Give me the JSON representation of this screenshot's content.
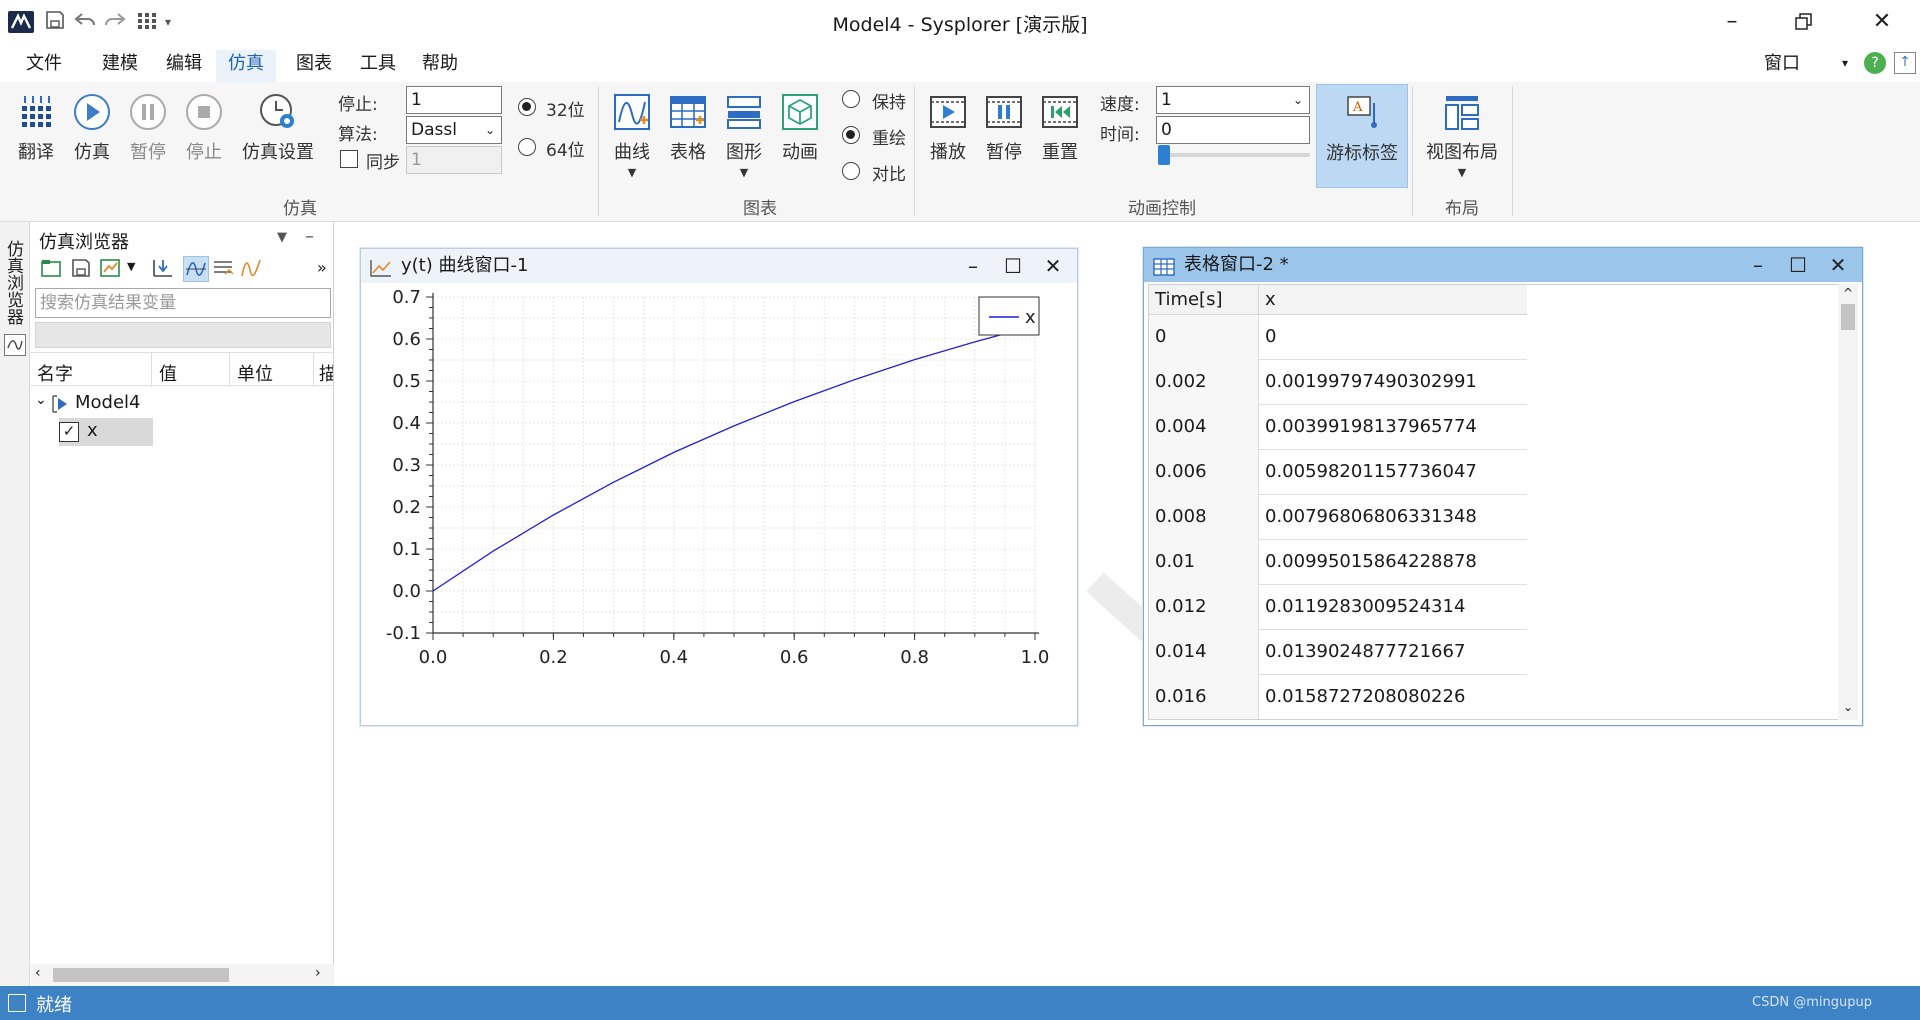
{
  "app": {
    "title": "Model4 - Sysplorer [演示版]"
  },
  "menu": {
    "items": [
      "文件",
      "建模",
      "编辑",
      "仿真",
      "图表",
      "工具",
      "帮助"
    ],
    "active": "仿真",
    "right_window_label": "窗口"
  },
  "ribbon": {
    "sim_group": {
      "label": "仿真",
      "buttons": [
        "翻译",
        "仿真",
        "暂停",
        "停止",
        "仿真设置"
      ],
      "stop_label": "停止:",
      "stop_value": "1",
      "algo_label": "算法:",
      "algo_value": "Dassl",
      "sync_label": "同步",
      "sync_value": "1",
      "bits32": "32位",
      "bits64": "64位"
    },
    "chart_group": {
      "label": "图表",
      "buttons": [
        "曲线",
        "表格",
        "图形",
        "动画"
      ],
      "modes": [
        "保持",
        "重绘",
        "对比"
      ],
      "selected_mode": "重绘"
    },
    "anim_group": {
      "label": "动画控制",
      "buttons": [
        "播放",
        "暂停",
        "重置"
      ],
      "speed_label": "速度:",
      "speed_value": "1",
      "time_label": "时间:",
      "time_value": "0",
      "cursor_label": "游标标签"
    },
    "layout_group": {
      "label": "布局",
      "button": "视图布局"
    }
  },
  "left_tab": "仿真浏览器",
  "browser": {
    "title": "仿真浏览器",
    "search_placeholder": "搜索仿真结果变量",
    "columns": [
      "名字",
      "值",
      "单位",
      "描"
    ],
    "tree": {
      "root": "Model4",
      "child": "x"
    }
  },
  "curve_window": {
    "title": "y(t) 曲线窗口-1"
  },
  "table_window": {
    "title": "表格窗口-2 *",
    "columns": [
      "Time[s]",
      "x"
    ],
    "rows": [
      [
        "0",
        "0"
      ],
      [
        "0.002",
        "0.00199797490302991"
      ],
      [
        "0.004",
        "0.00399198137965774"
      ],
      [
        "0.006",
        "0.00598201157736047"
      ],
      [
        "0.008",
        "0.00796806806331348"
      ],
      [
        "0.01",
        "0.00995015864228878"
      ],
      [
        "0.012",
        "0.0119283009524314"
      ],
      [
        "0.014",
        "0.0139024877721667"
      ],
      [
        "0.016",
        "0.0158727208080226"
      ]
    ]
  },
  "status": {
    "text": "就绪",
    "watermark": "CSDN @mingupup"
  },
  "chart_data": {
    "type": "line",
    "title": "",
    "xlabel": "",
    "ylabel": "",
    "xlim": [
      0.0,
      1.0
    ],
    "ylim": [
      -0.1,
      0.7
    ],
    "x_ticks": [
      "0.0",
      "0.2",
      "0.4",
      "0.6",
      "0.8",
      "1.0"
    ],
    "y_ticks": [
      "-0.1",
      "0.0",
      "0.1",
      "0.2",
      "0.3",
      "0.4",
      "0.5",
      "0.6",
      "0.7"
    ],
    "grid": true,
    "legend": "top-right",
    "series": [
      {
        "name": "x",
        "color": "#1f1fe0",
        "x": [
          0.0,
          0.1,
          0.2,
          0.3,
          0.4,
          0.5,
          0.6,
          0.7,
          0.8,
          0.9,
          1.0
        ],
        "y": [
          0.0,
          0.095,
          0.181,
          0.259,
          0.33,
          0.393,
          0.451,
          0.503,
          0.551,
          0.593,
          0.632
        ]
      }
    ]
  }
}
